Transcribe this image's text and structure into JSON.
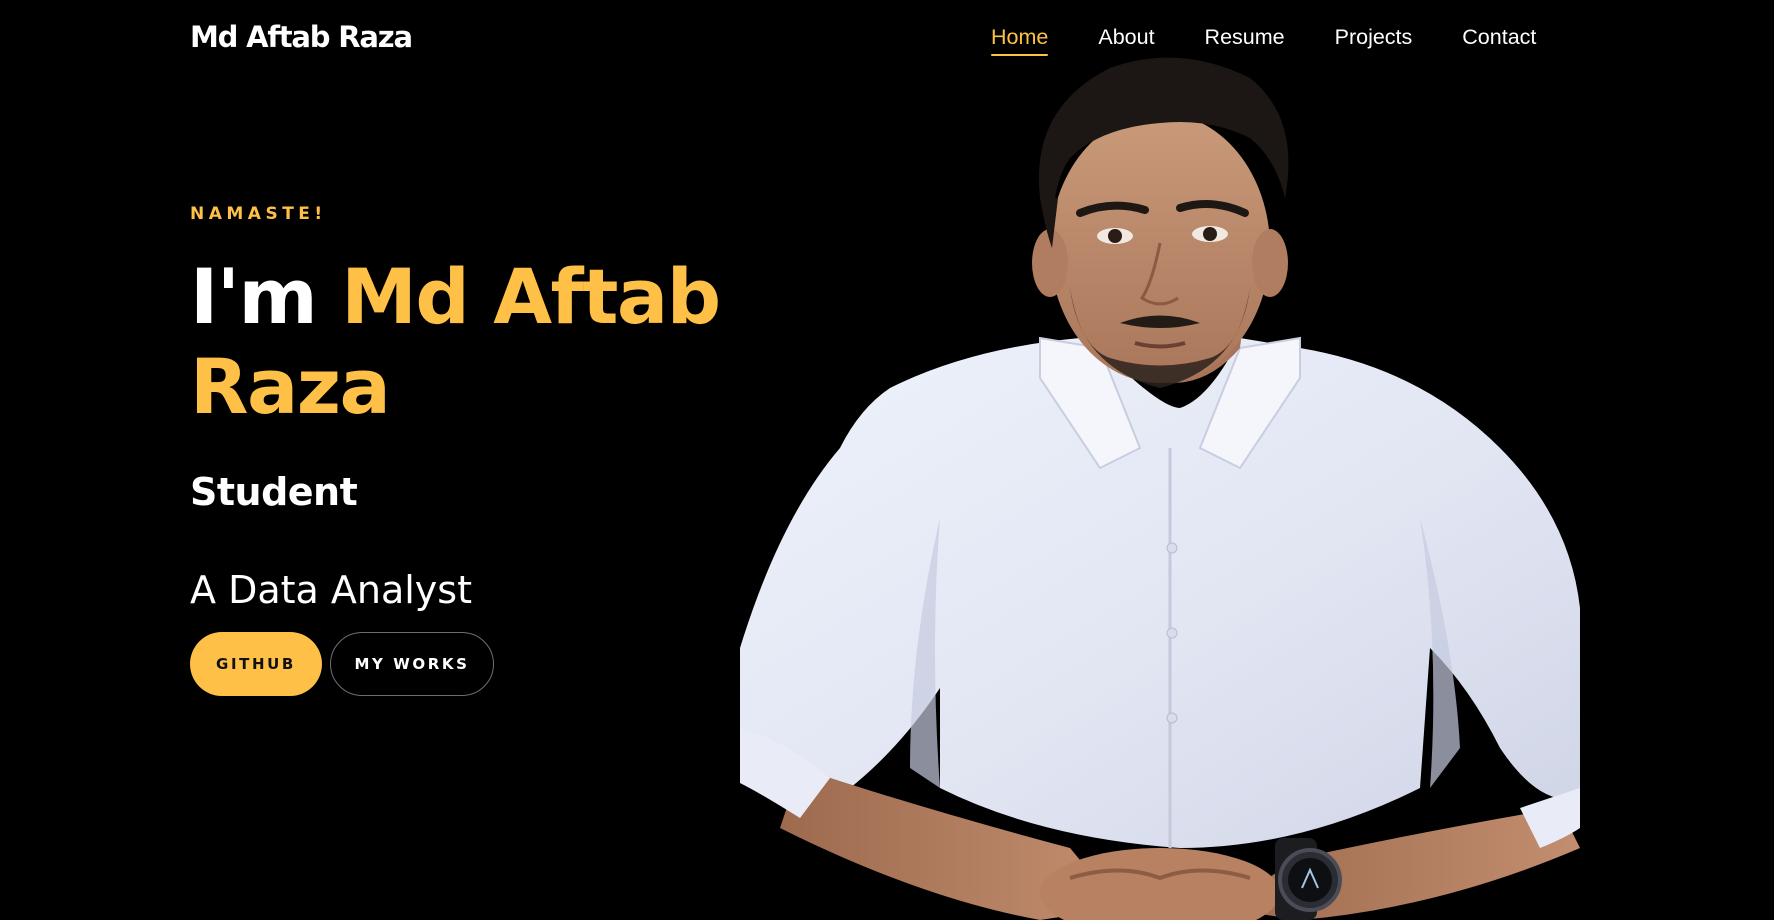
{
  "header": {
    "brand": "Md Aftab Raza",
    "nav": [
      {
        "label": "Home",
        "active": true
      },
      {
        "label": "About",
        "active": false
      },
      {
        "label": "Resume",
        "active": false
      },
      {
        "label": "Projects",
        "active": false
      },
      {
        "label": "Contact",
        "active": false
      }
    ]
  },
  "hero": {
    "greeting": "NAMASTE!",
    "title_prefix": "I'm",
    "title_name": "Md Aftab Raza",
    "role": "Student",
    "tagline": "A Data Analyst",
    "buttons": {
      "primary": "GITHUB",
      "secondary": "MY WORKS"
    }
  },
  "colors": {
    "accent": "#ffc047",
    "background": "#000000",
    "text": "#ffffff"
  },
  "images": {
    "portrait": "portrait-photo"
  }
}
